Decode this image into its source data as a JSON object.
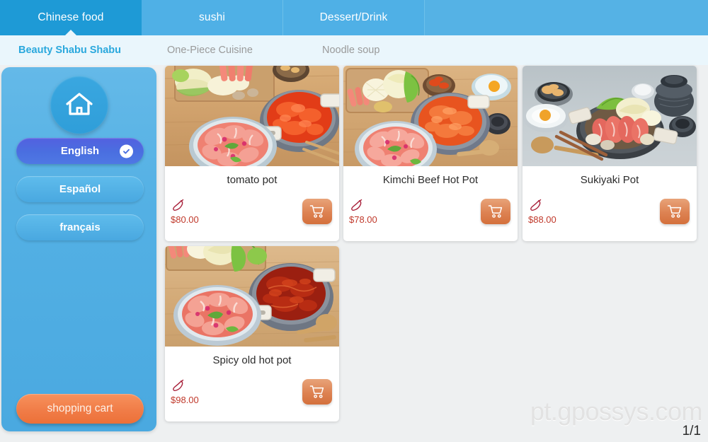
{
  "tabs": [
    {
      "label": "Chinese food",
      "active": true
    },
    {
      "label": "sushi",
      "active": false
    },
    {
      "label": "Dessert/Drink",
      "active": false
    }
  ],
  "subnav": [
    {
      "label": "Beauty Shabu Shabu",
      "active": true
    },
    {
      "label": "One-Piece Cuisine",
      "active": false
    },
    {
      "label": "Noodle soup",
      "active": false
    }
  ],
  "sidebar": {
    "home_icon": "home-icon",
    "languages": [
      {
        "label": "English",
        "selected": true
      },
      {
        "label": "Español",
        "selected": false
      },
      {
        "label": "français",
        "selected": false
      }
    ],
    "cart_label": "shopping cart"
  },
  "products": [
    {
      "name": "tomato pot",
      "price": "$80.00",
      "spicy_icon": "chili-pepper-icon",
      "cart_icon": "shopping-cart-icon"
    },
    {
      "name": "Kimchi Beef Hot Pot",
      "price": "$78.00",
      "spicy_icon": "chili-pepper-icon",
      "cart_icon": "shopping-cart-icon"
    },
    {
      "name": "Sukiyaki Pot",
      "price": "$88.00",
      "spicy_icon": "chili-pepper-icon",
      "cart_icon": "shopping-cart-icon"
    },
    {
      "name": "Spicy old hot pot",
      "price": "$98.00",
      "spicy_icon": "chili-pepper-icon",
      "cart_icon": "shopping-cart-icon"
    }
  ],
  "footer": {
    "watermark": "pt.gpossys.com",
    "pager": "1/1"
  },
  "colors": {
    "tab_active": "#1e9ad6",
    "tab_bar": "#55b2e5",
    "subnav_bg": "#eaf6fc",
    "subnav_active_text": "#2aa8dd",
    "sidebar_bg": "#53b0e4",
    "lang_selected": "#4a6fe0",
    "cart_orange": "#f07b46",
    "price_red": "#c0392b"
  }
}
